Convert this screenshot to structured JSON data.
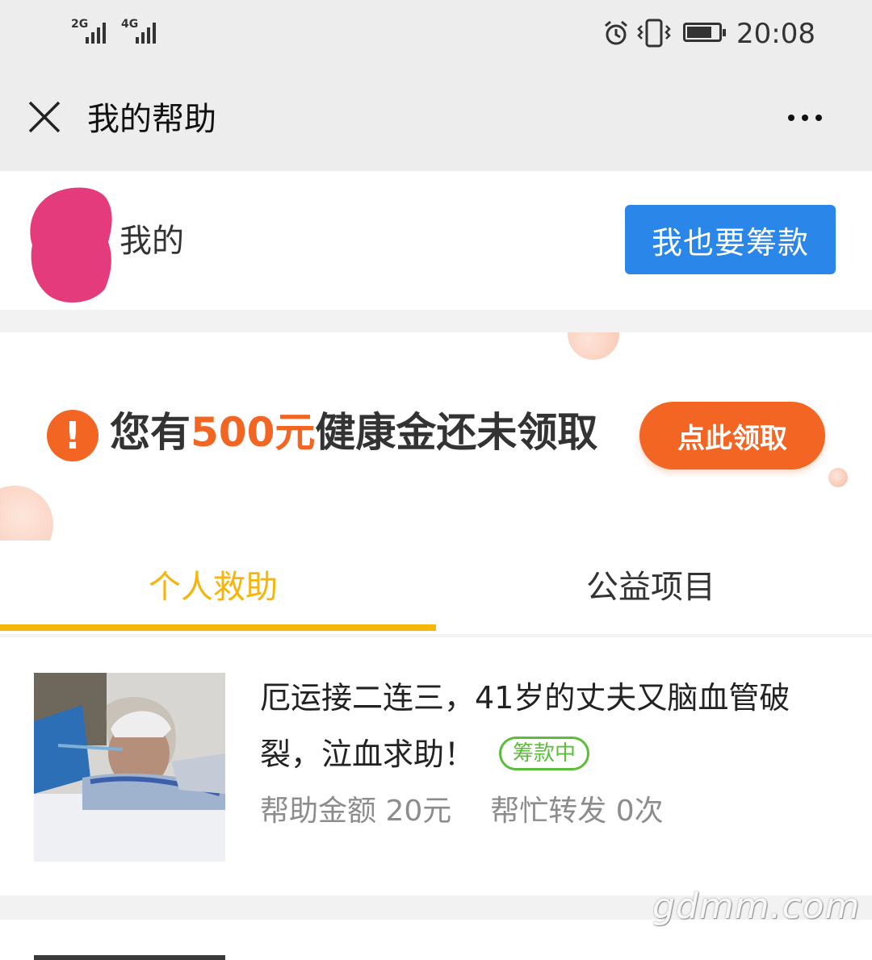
{
  "status_bar": {
    "time": "20:08",
    "sim1": "2G",
    "sim2": "4G"
  },
  "navbar": {
    "title": "我的帮助"
  },
  "profile": {
    "name": "我的",
    "fund_button": "我也要筹款"
  },
  "banner": {
    "prefix": "您有",
    "amount": "500元",
    "suffix": "健康金还未领取",
    "claim_button": "点此领取"
  },
  "tabs": [
    {
      "label": "个人救助",
      "active": true
    },
    {
      "label": "公益项目",
      "active": false
    }
  ],
  "items": [
    {
      "title": "厄运接二连三，41岁的丈夫又脑血管破裂，泣血求助！",
      "badge": "筹款中",
      "help_amount": "帮助金额 20元",
      "shares": "帮忙转发 0次"
    }
  ],
  "watermark": "gdmm.com",
  "colors": {
    "accent_blue": "#2a86e8",
    "accent_orange": "#f26522",
    "tab_active": "#f5b50c",
    "badge_green": "#5bbd3a"
  }
}
